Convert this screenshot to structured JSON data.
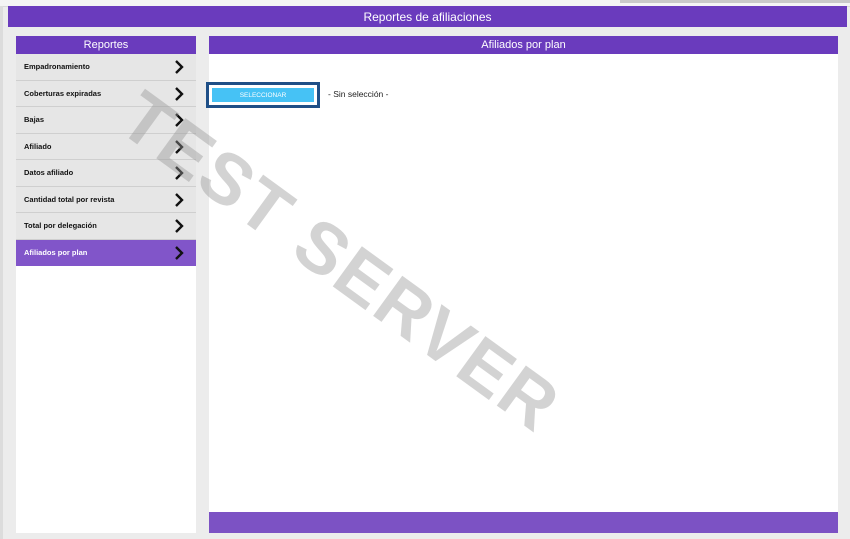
{
  "header": {
    "title": "Reportes de afiliaciones"
  },
  "sidebar": {
    "title": "Reportes",
    "items": [
      {
        "label": "Empadronamiento",
        "active": false
      },
      {
        "label": "Coberturas expiradas",
        "active": false
      },
      {
        "label": "Bajas",
        "active": false
      },
      {
        "label": "Afiliado",
        "active": false
      },
      {
        "label": "Datos afiliado",
        "active": false
      },
      {
        "label": "Cantidad total por revista",
        "active": false
      },
      {
        "label": "Total por delegación",
        "active": false
      },
      {
        "label": "Afiliados por plan",
        "active": true
      }
    ]
  },
  "content": {
    "title": "Afiliados por plan",
    "select_button_label": "SELECCIONAR",
    "selection_status": "- Sin selección -"
  },
  "watermark": {
    "text": "TEST SERVER"
  },
  "colors": {
    "header_purple": "#6a3bbd",
    "active_purple": "#8155c9",
    "footer_purple": "#7c52c4",
    "button_blue": "#46c2f5",
    "button_border": "#1f4f87"
  }
}
